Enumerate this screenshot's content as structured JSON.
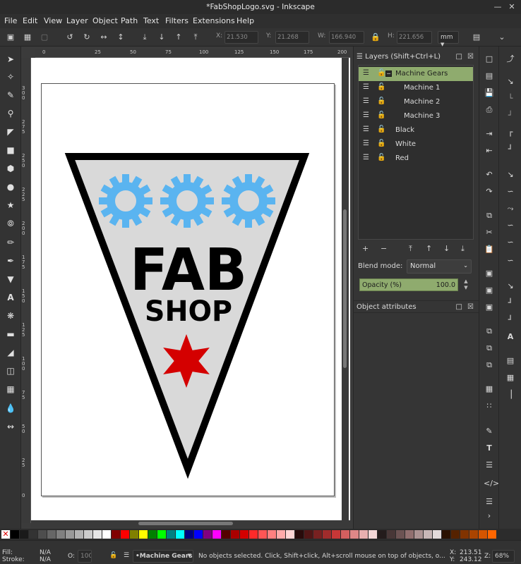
{
  "window": {
    "title": "*FabShopLogo.svg - Inkscape",
    "minimize_icon": "minimize-icon",
    "close_icon": "close-icon"
  },
  "menu": [
    "File",
    "Edit",
    "View",
    "Layer",
    "Object",
    "Path",
    "Text",
    "Filters",
    "Extensions",
    "Help"
  ],
  "toolbar": {
    "x_label": "X:",
    "x_value": "21.530",
    "y_label": "Y:",
    "y_value": "21.268",
    "w_label": "W:",
    "w_value": "166.940",
    "h_label": "H:",
    "h_value": "221.656",
    "unit": "mm"
  },
  "ruler": {
    "top": [
      "0",
      "25",
      "50",
      "75",
      "100",
      "125",
      "150",
      "175",
      "200"
    ],
    "left": [
      "300",
      "275",
      "250",
      "225",
      "200",
      "175",
      "150",
      "125",
      "100",
      "75",
      "50",
      "25",
      "0"
    ]
  },
  "logo": {
    "line1": "FAB",
    "line2": "SHOP",
    "gear_color": "#5ab4f0",
    "star_color": "#d40000",
    "fill_color": "#d9d9d9",
    "stroke_color": "#000000"
  },
  "layers_panel": {
    "title": "Layers (Shift+Ctrl+L)",
    "layers": [
      {
        "name": "Machine Gears",
        "selected": true,
        "indent": 0,
        "collapsible": true
      },
      {
        "name": "Machine 1",
        "selected": false,
        "indent": 1
      },
      {
        "name": "Machine 2",
        "selected": false,
        "indent": 1
      },
      {
        "name": "Machine 3",
        "selected": false,
        "indent": 1
      },
      {
        "name": "Black",
        "selected": false,
        "indent": 0
      },
      {
        "name": "White",
        "selected": false,
        "indent": 0
      },
      {
        "name": "Red",
        "selected": false,
        "indent": 0
      }
    ],
    "blend_label": "Blend mode:",
    "blend_value": "Normal",
    "opacity_label": "Opacity (%)",
    "opacity_value": "100.0"
  },
  "object_attributes": {
    "title": "Object attributes"
  },
  "palette": [
    "#000000",
    "#1a1a1a",
    "#333333",
    "#4d4d4d",
    "#666666",
    "#808080",
    "#999999",
    "#b3b3b3",
    "#cccccc",
    "#e6e6e6",
    "#ffffff",
    "#800000",
    "#ff0000",
    "#808000",
    "#ffff00",
    "#008000",
    "#00ff00",
    "#008080",
    "#00ffff",
    "#000080",
    "#0000ff",
    "#800080",
    "#ff00ff",
    "#550000",
    "#aa0000",
    "#d40000",
    "#ff2a2a",
    "#ff5555",
    "#ff8080",
    "#ffaaaa",
    "#ffd5d5",
    "#280b0b",
    "#501616",
    "#782121",
    "#a02c2c",
    "#c83737",
    "#d35f5f",
    "#de8787",
    "#e9afaf",
    "#f4d7d7",
    "#241c1c",
    "#483737",
    "#6c5353",
    "#916f6f",
    "#ac9393",
    "#c8b7b7",
    "#e3dbdb",
    "#2b1100",
    "#552200",
    "#803300",
    "#aa4400",
    "#d45500",
    "#ff6600"
  ],
  "status": {
    "fill_label": "Fill:",
    "fill_value": "N/A",
    "stroke_label": "Stroke:",
    "stroke_value": "N/A",
    "opacity_label": "O:",
    "opacity_value": "100",
    "layer": "•Machine Gears",
    "message": "No objects selected. Click, Shift+click, Alt+scroll mouse on top of objects, o...",
    "cursor_x_label": "X:",
    "cursor_x": "213.51",
    "cursor_y_label": "Y:",
    "cursor_y": "243.12",
    "zoom_label": "Z:",
    "zoom": "68%"
  }
}
